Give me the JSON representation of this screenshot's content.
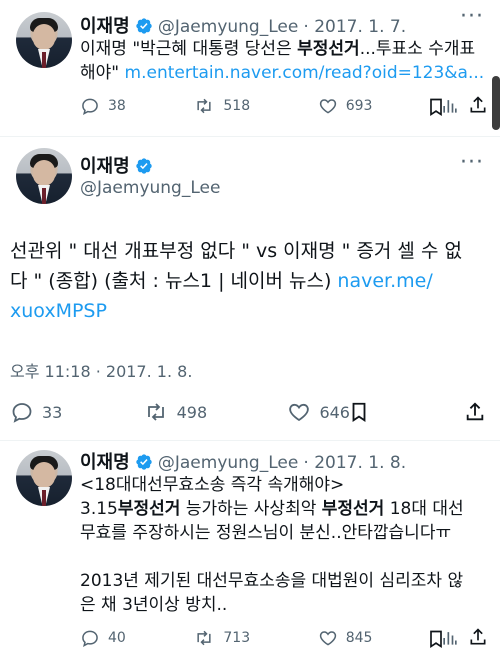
{
  "tweet1": {
    "name": "이재명",
    "handle": "@Jaemyung_Lee",
    "date": "· 2017. 1. 7.",
    "line1_pre": "이재명 \"박근혜 대통령 당선은 ",
    "line1_bold": "부정선거",
    "line1_post": "...투표소 수개표",
    "line2_pre": "해야\" ",
    "link": "m.entertain.naver.com/read?oid=123&a...",
    "replies": "38",
    "retweets": "518",
    "likes": "693"
  },
  "tweet2": {
    "name": "이재명",
    "handle": "@Jaemyung_Lee",
    "line1": "선관위  \" 대선 개표부정 없다 \" vs 이재명  \" 증거 셀 수 없",
    "line2_pre": "다 \" (종합) (출처 : 뉴스1 | 네이버 뉴스) ",
    "link_part1": "naver.me/",
    "link_part2": "xuoxMPSP",
    "timestamp": "오후 11:18 · 2017. 1. 8.",
    "replies": "33",
    "retweets": "498",
    "likes": "646"
  },
  "tweet3": {
    "name": "이재명",
    "handle": "@Jaemyung_Lee",
    "date": "· 2017. 1. 8.",
    "line1": "<18대대선무효소송 즉각 속개해야>",
    "line2_a": "3.15",
    "line2_b": "부정선거",
    "line2_c": " 능가하는 사상최악 ",
    "line2_d": "부정선거",
    "line2_e": " 18대 대선",
    "line3": "무효를 주장하시는 정원스님이 분신..안타깝습니다ㅠ",
    "line4": "2013년 제기된 대선무효소송을 대법원이 심리조차 않",
    "line5": "은 채 3년이상 방치..",
    "replies": "40",
    "retweets": "713",
    "likes": "845"
  },
  "colors": {
    "accent": "#1d9bf0",
    "secondary_text": "#536471",
    "verified": "#1d9bf0"
  },
  "icons": [
    "verified-badge-icon",
    "reply-icon",
    "retweet-icon",
    "like-icon",
    "views-icon",
    "bookmark-icon",
    "share-icon",
    "more-icon"
  ]
}
